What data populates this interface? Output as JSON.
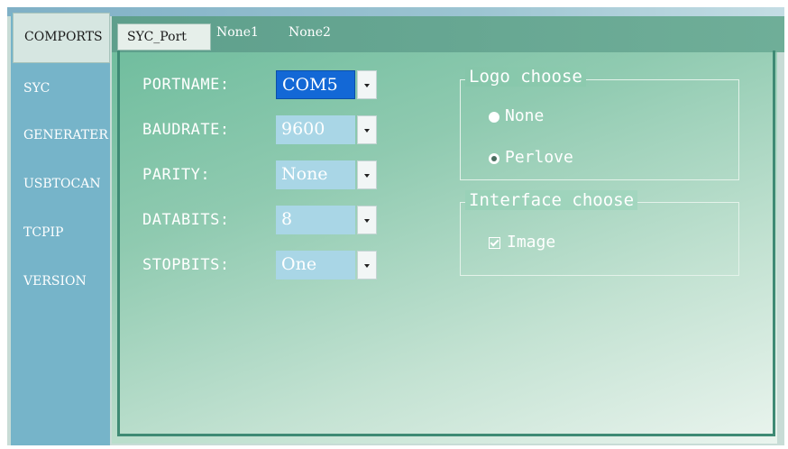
{
  "sidebar": {
    "items": [
      {
        "label": "COMPORTS",
        "active": true
      },
      {
        "label": "SYC"
      },
      {
        "label": "GENERATER"
      },
      {
        "label": "USBTOCAN"
      },
      {
        "label": "TCPIP"
      },
      {
        "label": "VERSION"
      }
    ]
  },
  "tabs": [
    {
      "label": "SYC_Port",
      "active": true
    },
    {
      "label": "None1"
    },
    {
      "label": "None2"
    }
  ],
  "form": {
    "portname": {
      "label": "PORTNAME:",
      "value": "COM5"
    },
    "baudrate": {
      "label": "BAUDRATE:",
      "value": "9600"
    },
    "parity": {
      "label": "PARITY:",
      "value": "None"
    },
    "databits": {
      "label": "DATABITS:",
      "value": "8"
    },
    "stopbits": {
      "label": "STOPBITS:",
      "value": "One"
    }
  },
  "logo_group": {
    "title": "Logo choose",
    "options": [
      {
        "label": "None",
        "checked": false
      },
      {
        "label": "Perlove",
        "checked": true
      }
    ]
  },
  "interface_group": {
    "title": "Interface choose",
    "image_checkbox": {
      "label": "Image",
      "checked": true
    }
  },
  "colors": {
    "accent": "#1368d6",
    "sidebar": "#76b4c9",
    "content_top": "#6bbb9b",
    "tabbar": "#5e9f8c"
  }
}
